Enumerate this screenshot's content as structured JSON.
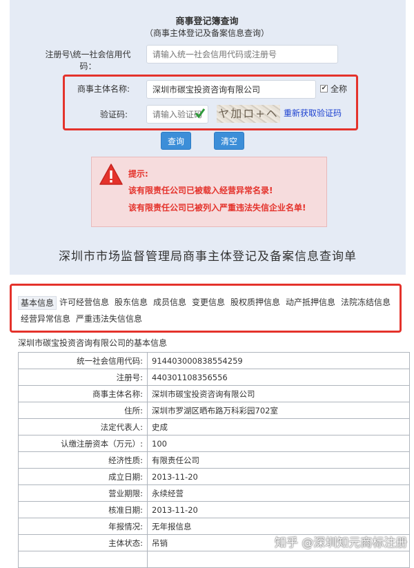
{
  "search": {
    "title": "商事登记簿查询",
    "subtitle": "（商事主体登记及备案信息查询）",
    "code_label_line1": "注册号\\统一社会信用代",
    "code_label_line2": "码：",
    "code_placeholder": "请输入统一社会信用代码或注册号",
    "name_label": "商事主体名称:",
    "name_value": "深圳市碳宝投资咨询有限公司",
    "fullname_checked": "✔",
    "fullname_label": "全称",
    "captcha_label": "验证码:",
    "captcha_placeholder": "请输入验证码",
    "captcha_ok_icon": "check-icon",
    "captcha_text": "ヤ加ロ+ヘ",
    "refresh_link": "重新获取验证码",
    "query_button": "查询",
    "clear_button": "清空"
  },
  "alert": {
    "title": "提示:",
    "line1": "该有限责任公司已被载入经营异常名录!",
    "line2": "该有限责任公司已被列入严重违法失信企业名单!",
    "icon": "warning-icon",
    "color": "#e4322b"
  },
  "heading": "深圳市市场监督管理局商事主体登记及备案信息查询单",
  "tabs": [
    {
      "label": "基本信息"
    },
    {
      "label": "许可经营信息"
    },
    {
      "label": "股东信息"
    },
    {
      "label": "成员信息"
    },
    {
      "label": "变更信息"
    },
    {
      "label": "股权质押信息"
    },
    {
      "label": "动产抵押信息"
    },
    {
      "label": "法院冻结信息"
    },
    {
      "label": "经营异常信息"
    },
    {
      "label": "严重违法失信信息"
    }
  ],
  "section_title": "深圳市碳宝投资咨询有限公司的基本信息",
  "info_rows": [
    {
      "key": "统一社会信用代码:",
      "value": "914403000838554259"
    },
    {
      "key": "注册号:",
      "value": "440301108356556"
    },
    {
      "key": "商事主体名称:",
      "value": "深圳市碳宝投资咨询有限公司"
    },
    {
      "key": "住所:",
      "value": "深圳市罗湖区晒布路万科彩园702室"
    },
    {
      "key": "法定代表人:",
      "value": "史成"
    },
    {
      "key": "认缴注册资本（万元）:",
      "value": "100"
    },
    {
      "key": "经济性质:",
      "value": "有限责任公司"
    },
    {
      "key": "成立日期:",
      "value": "2013-11-20"
    },
    {
      "key": "营业期限:",
      "value": "永续经营"
    },
    {
      "key": "核准日期:",
      "value": "2013-11-20"
    },
    {
      "key": "年报情况:",
      "value": "无年报信息"
    },
    {
      "key": "主体状态:",
      "value": "吊销"
    },
    {
      "key": "",
      "value": ""
    }
  ],
  "watermark": "知乎 @深圳知元商标注册",
  "colors": {
    "accent_blue": "#3c8ed8",
    "highlight_red": "#e4322b",
    "panel_bg": "#e5ebf5"
  }
}
